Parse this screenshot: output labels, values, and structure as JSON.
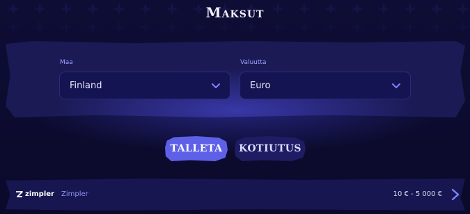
{
  "header": {
    "title": "Maksut"
  },
  "filters": {
    "country": {
      "label": "Maa",
      "value": "Finland"
    },
    "currency": {
      "label": "Valuutta",
      "value": "Euro"
    }
  },
  "tabs": [
    {
      "label": "TALLETA",
      "active": true
    },
    {
      "label": "KOTIUTUS",
      "active": false
    }
  ],
  "payment_methods": [
    {
      "logo_text": "zimpler",
      "name": "Zimpler",
      "limits": "10 € - 5 000 €"
    }
  ],
  "icons": {
    "select_chevron": "chevron-down-icon",
    "row_arrow": "chevron-right-icon",
    "logo_mark": "zimpler-logo-icon"
  },
  "colors": {
    "background": "#0c0b2e",
    "panel": "#1b1a55",
    "accent": "#5e61e8",
    "label": "#9ea2ff",
    "chevron": "#7e84ff"
  }
}
